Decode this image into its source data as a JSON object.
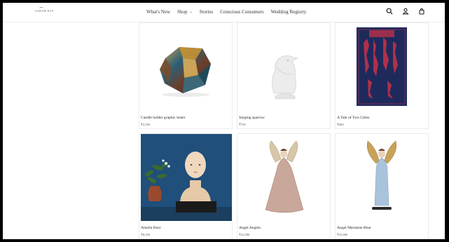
{
  "header": {
    "logo": "SARAH BAY",
    "nav": [
      {
        "label": "What's New",
        "name": "nav-whats-new"
      },
      {
        "label": "Shop",
        "name": "nav-shop"
      },
      {
        "label": "Stories",
        "name": "nav-stories"
      },
      {
        "label": "Conscious Consumers",
        "name": "nav-conscious-consumers"
      },
      {
        "label": "Wedding Registry",
        "name": "nav-wedding-registry"
      }
    ],
    "icons": [
      "search-icon",
      "account-icon",
      "cart-icon"
    ]
  },
  "products": [
    {
      "title": "Candle holder graphic luster",
      "price": "₹2,500"
    },
    {
      "title": "Singing sparrow",
      "price": "₹750"
    },
    {
      "title": "A Tale of Two Cities",
      "price": "₹600"
    },
    {
      "title": "Amelia Bust",
      "price": "₹8,500"
    },
    {
      "title": "Angel Angela",
      "price": "₹22,000"
    },
    {
      "title": "Angel Marianne Blue",
      "price": "₹25,000"
    }
  ],
  "colors": {
    "book_cover": "#1e2a5c",
    "book_accent": "#b0304a",
    "bust_background": "#1f4f7a"
  }
}
